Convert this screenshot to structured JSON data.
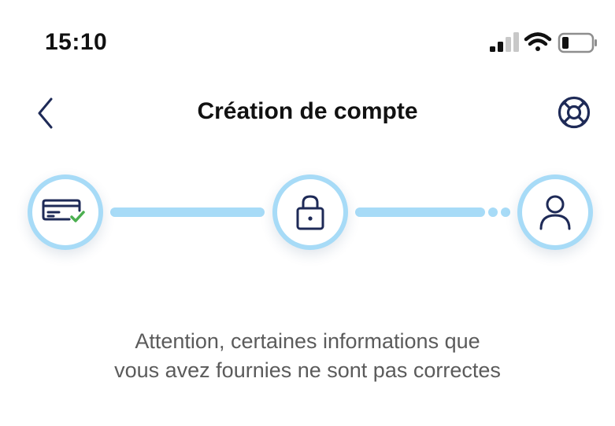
{
  "status_bar": {
    "time": "15:10",
    "icons": [
      "signal-icon",
      "wifi-icon",
      "battery-icon"
    ]
  },
  "header": {
    "title": "Création de compte",
    "back_icon": "chevron-left-icon",
    "help_icon": "lifebuoy-icon"
  },
  "stepper": {
    "steps": [
      {
        "icon": "card-check-icon",
        "state": "completed"
      },
      {
        "icon": "lock-icon",
        "state": "current"
      },
      {
        "icon": "user-icon",
        "state": "upcoming"
      }
    ]
  },
  "message": {
    "line1": "Attention, certaines informations que",
    "line2": "vous avez fournies ne sont pas correctes"
  },
  "colors": {
    "navy": "#1e2a57",
    "accent_light_blue": "#a7dbf7",
    "check_green": "#4caf50",
    "message_gray": "#5b5b5b"
  }
}
